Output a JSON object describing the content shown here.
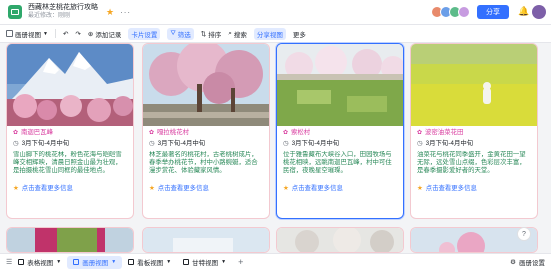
{
  "header": {
    "title": "西藏林芝桃花旅行攻略",
    "subtitle": "最近修改：刚刚",
    "share_label": "分享",
    "colors": {
      "brand": "#2fa86b",
      "accent": "#3370ff"
    }
  },
  "toolbar": {
    "view_label": "画册视图",
    "items": [
      {
        "label": "添加记录",
        "icon": "plus-icon"
      },
      {
        "label": "卡片设置",
        "icon": "card-settings-icon",
        "active": true
      },
      {
        "label": "筛选",
        "icon": "filter-icon",
        "active": true
      },
      {
        "label": "排序",
        "icon": "sort-icon"
      },
      {
        "label": "搜索",
        "icon": "search-icon"
      },
      {
        "label": "分享视图",
        "icon": "share-view-icon",
        "active": true
      },
      {
        "label": "更多",
        "icon": "more-icon"
      }
    ]
  },
  "cards": [
    {
      "title": "南迦巴瓦峰",
      "time": "3月下旬-4月中旬",
      "desc": "雪山脚下的桃花林，粉色花海与皑皑雪峰交相辉映，清晨日照金山最为壮观，是拍摄桃花雪山同框的最佳地点。",
      "link": "点击查看更多信息"
    },
    {
      "title": "嘎拉桃花村",
      "time": "3月下旬-4月中旬",
      "desc": "林芝最著名的桃花村，古老桃树成片，春季举办桃花节，村中小路蜿蜒，适合漫步赏花、体验藏家风情。",
      "link": "点击查看更多信息"
    },
    {
      "title": "索松村",
      "time": "3月下旬-4月中旬",
      "desc": "位于雅鲁藏布大峡谷入口，田园牧场与桃花相映，远眺南迦巴瓦峰，村中可住民宿，夜晚星空璀璨。",
      "link": "点击查看更多信息"
    },
    {
      "title": "波密油菜花田",
      "time": "3月下旬-4月中旬",
      "desc": "油菜花与桃花同季盛开，金黄花田一望无际，远处雪山点缀，色彩层次丰富，是春季摄影爱好者的天堂。",
      "link": "点击查看更多信息"
    }
  ],
  "tabs": [
    {
      "label": "表格视图",
      "active": false
    },
    {
      "label": "画册视图",
      "active": true
    },
    {
      "label": "看板视图",
      "active": false
    },
    {
      "label": "甘特视图",
      "active": false
    }
  ],
  "zoom_label": "画册设置",
  "help_label": "?"
}
